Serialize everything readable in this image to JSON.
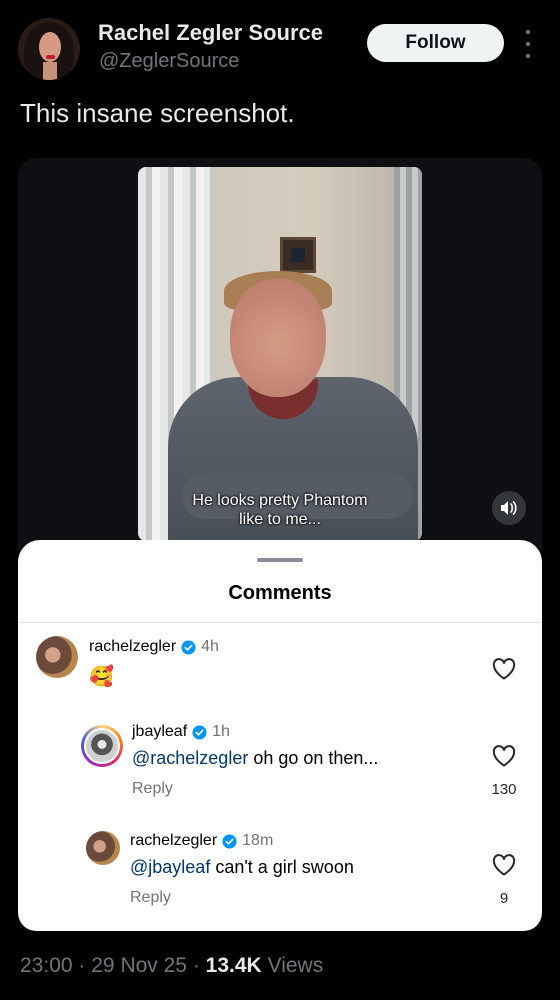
{
  "post": {
    "display_name": "Rachel Zegler Source",
    "handle": "@ZeglerSource",
    "follow_label": "Follow",
    "text": "This insane screenshot.",
    "time": "23:00",
    "separator": "·",
    "date": "29 Nov 25",
    "views_count": "13.4K",
    "views_label": "Views"
  },
  "video": {
    "caption_line1": "He looks pretty Phantom",
    "caption_line2": "like to me..."
  },
  "comments_sheet": {
    "title": "Comments",
    "comments": [
      {
        "username": "rachelzegler",
        "time": "4h",
        "text": "🥰",
        "likes": ""
      },
      {
        "username": "jbayleaf",
        "time": "1h",
        "mention": "@rachelzegler",
        "text": " oh go on then...",
        "reply_label": "Reply",
        "likes": "130"
      },
      {
        "username": "rachelzegler",
        "time": "18m",
        "mention": "@jbayleaf",
        "text": " can't a girl swoon",
        "reply_label": "Reply",
        "likes": "9"
      }
    ]
  },
  "colors": {
    "background": "#000000",
    "text_primary": "#e7e9ea",
    "text_secondary": "#71767b",
    "verified_blue": "#0095f6",
    "mention_blue": "#00376b"
  }
}
